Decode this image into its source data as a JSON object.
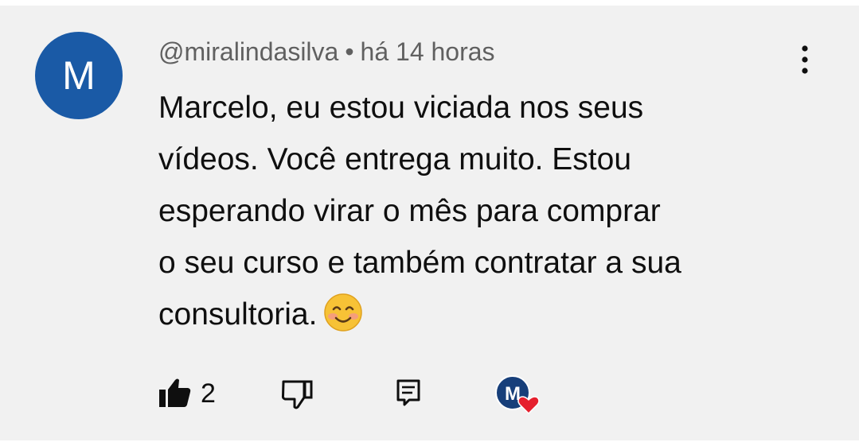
{
  "comment": {
    "avatar_letter": "M",
    "username": "@miralindasilva",
    "separator": "•",
    "timestamp": "há 14 horas",
    "lines": [
      "Marcelo, eu estou viciada nos seus",
      "vídeos. Você entrega muito. Estou",
      "esperando virar o mês para comprar",
      "o seu curso e também contratar a sua",
      "consultoria."
    ],
    "emoji_icon": "smiling-face-emoji"
  },
  "actions": {
    "like_icon": "thumbs-up-filled-icon",
    "like_count": "2",
    "dislike_icon": "thumbs-down-icon",
    "reply_icon": "reply-comment-icon",
    "creator_heart_icon": "creator-heart-avatar-icon",
    "creator_avatar_letter": "M"
  },
  "menu": {
    "more_icon": "more-vertical-icon"
  },
  "colors": {
    "background": "#f1f1f1",
    "avatar": "#1a5aa6",
    "meta_text": "#606060",
    "body_text": "#0f0f0f",
    "heart": "#e5202e"
  }
}
